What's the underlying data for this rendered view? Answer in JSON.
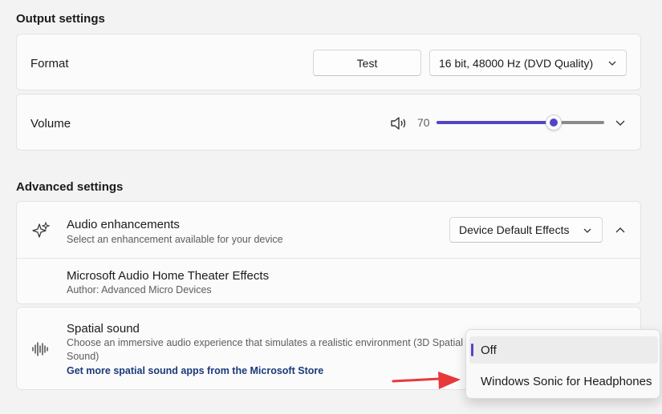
{
  "output": {
    "title": "Output settings",
    "format_label": "Format",
    "test_label": "Test",
    "format_value": "16 bit, 48000 Hz (DVD Quality)",
    "volume_label": "Volume",
    "volume_value": "70",
    "volume_level": 0.7
  },
  "advanced": {
    "title": "Advanced settings",
    "enhancements_label": "Audio enhancements",
    "enhancements_sub": "Select an enhancement available for your device",
    "enhancements_value": "Device Default Effects",
    "effects_label": "Microsoft Audio Home Theater Effects",
    "effects_sub": "Author: Advanced Micro Devices",
    "spatial_label": "Spatial sound",
    "spatial_desc_1": "Choose an immersive audio experience that simulates a realistic environment (3D Spatial",
    "spatial_desc_2": "Sound)",
    "spatial_link": "Get more spatial sound apps from the Microsoft Store"
  },
  "spatial_menu": {
    "options": [
      "Off",
      "Windows Sonic for Headphones"
    ],
    "selected": "Off"
  },
  "colors": {
    "accent": "#5346c4",
    "arrow": "#e8383b"
  },
  "icons": [
    "speaker-icon",
    "sparkle-icon",
    "sound-wave-icon",
    "chevron-down-icon",
    "chevron-up-icon",
    "red-arrow"
  ]
}
